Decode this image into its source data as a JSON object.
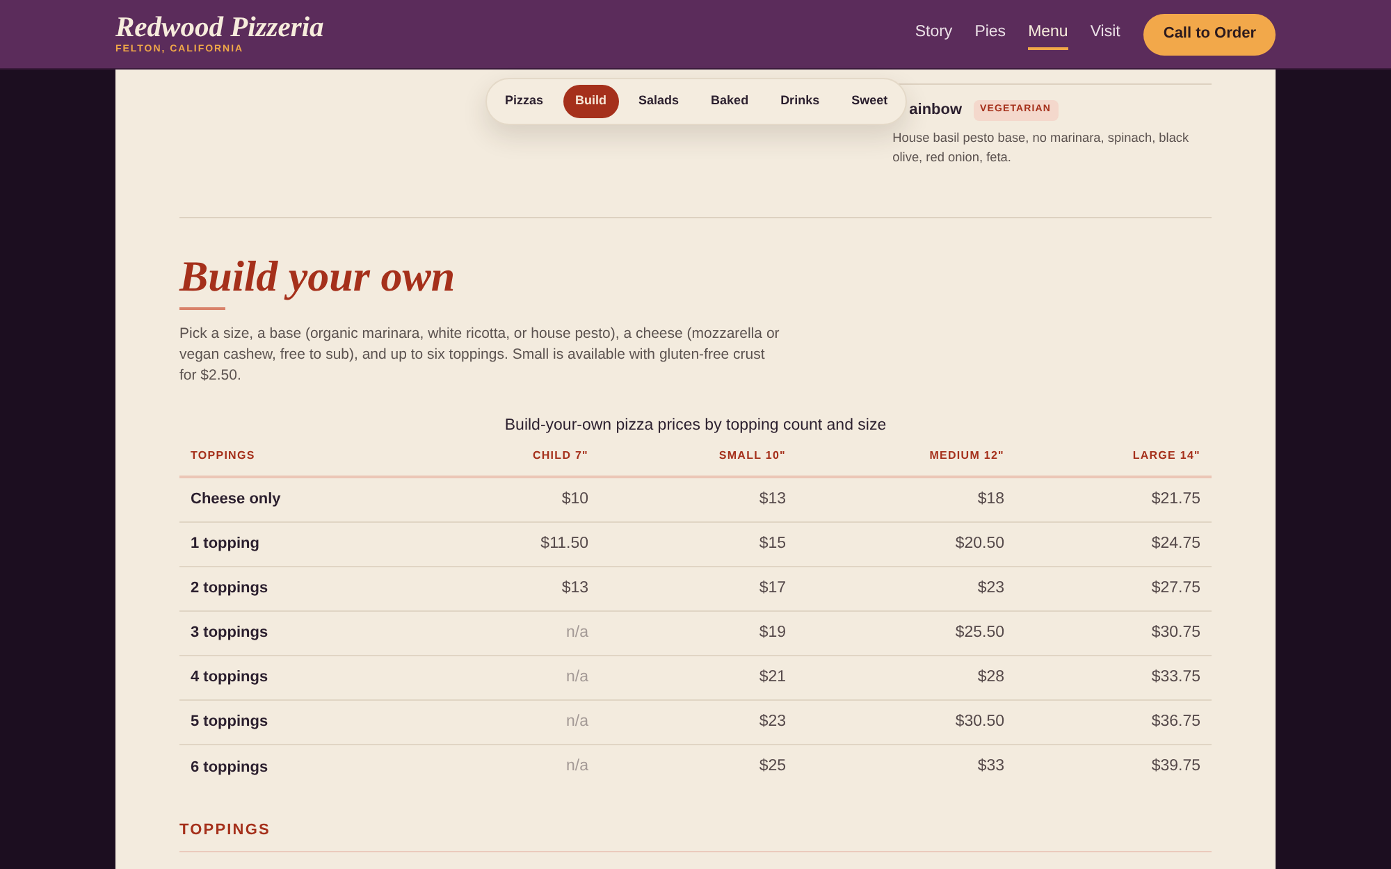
{
  "header": {
    "logo": "Redwood Pizzeria",
    "tagline": "FELTON, CALIFORNIA",
    "nav": [
      {
        "label": "Story",
        "selected": false
      },
      {
        "label": "Pies",
        "selected": false
      },
      {
        "label": "Menu",
        "selected": true
      },
      {
        "label": "Visit",
        "selected": false
      }
    ],
    "cta": "Call to Order"
  },
  "category_tabs": [
    {
      "label": "Pizzas",
      "selected": false
    },
    {
      "label": "Build",
      "selected": true
    },
    {
      "label": "Salads",
      "selected": false
    },
    {
      "label": "Baked",
      "selected": false
    },
    {
      "label": "Drinks",
      "selected": false
    },
    {
      "label": "Sweet",
      "selected": false
    }
  ],
  "previous_item": {
    "name": "ainbow",
    "badge": "VEGETARIAN",
    "description": "House basil pesto base, no marinara, spinach, black olive, red onion, feta."
  },
  "section": {
    "title": "Build your own",
    "intro": "Pick a size, a base (organic marinara, white ricotta, or house pesto), a cheese (mozzarella or vegan cashew, free to sub), and up to six toppings. Small is available with gluten-free crust for $2.50.",
    "table": {
      "caption": "Build-your-own pizza prices by topping count and size",
      "columns": [
        "TOPPINGS",
        "CHILD 7\"",
        "SMALL 10\"",
        "MEDIUM 12\"",
        "LARGE 14\""
      ],
      "rows": [
        {
          "cells": [
            {
              "kind": "label",
              "value": "Cheese only"
            },
            {
              "kind": "price",
              "value": "$10",
              "disabled": false
            },
            {
              "kind": "price",
              "value": "$13",
              "disabled": false
            },
            {
              "kind": "price",
              "value": "$18",
              "disabled": false
            },
            {
              "kind": "price",
              "value": "$21.75",
              "disabled": false
            }
          ]
        },
        {
          "cells": [
            {
              "kind": "label",
              "value": "1 topping"
            },
            {
              "kind": "price",
              "value": "$11.50",
              "disabled": false
            },
            {
              "kind": "price",
              "value": "$15",
              "disabled": false
            },
            {
              "kind": "price",
              "value": "$20.50",
              "disabled": false
            },
            {
              "kind": "price",
              "value": "$24.75",
              "disabled": false
            }
          ]
        },
        {
          "cells": [
            {
              "kind": "label",
              "value": "2 toppings"
            },
            {
              "kind": "price",
              "value": "$13",
              "disabled": false
            },
            {
              "kind": "price",
              "value": "$17",
              "disabled": false
            },
            {
              "kind": "price",
              "value": "$23",
              "disabled": false
            },
            {
              "kind": "price",
              "value": "$27.75",
              "disabled": false
            }
          ]
        },
        {
          "cells": [
            {
              "kind": "label",
              "value": "3 toppings"
            },
            {
              "kind": "price",
              "value": "n/a",
              "disabled": true
            },
            {
              "kind": "price",
              "value": "$19",
              "disabled": false
            },
            {
              "kind": "price",
              "value": "$25.50",
              "disabled": false
            },
            {
              "kind": "price",
              "value": "$30.75",
              "disabled": false
            }
          ]
        },
        {
          "cells": [
            {
              "kind": "label",
              "value": "4 toppings"
            },
            {
              "kind": "price",
              "value": "n/a",
              "disabled": true
            },
            {
              "kind": "price",
              "value": "$21",
              "disabled": false
            },
            {
              "kind": "price",
              "value": "$28",
              "disabled": false
            },
            {
              "kind": "price",
              "value": "$33.75",
              "disabled": false
            }
          ]
        },
        {
          "cells": [
            {
              "kind": "label",
              "value": "5 toppings"
            },
            {
              "kind": "price",
              "value": "n/a",
              "disabled": true
            },
            {
              "kind": "price",
              "value": "$23",
              "disabled": false
            },
            {
              "kind": "price",
              "value": "$30.50",
              "disabled": false
            },
            {
              "kind": "price",
              "value": "$36.75",
              "disabled": false
            }
          ]
        },
        {
          "cells": [
            {
              "kind": "label",
              "value": "6 toppings"
            },
            {
              "kind": "price",
              "value": "n/a",
              "disabled": true
            },
            {
              "kind": "price",
              "value": "$25",
              "disabled": false
            },
            {
              "kind": "price",
              "value": "$33",
              "disabled": false
            },
            {
              "kind": "price",
              "value": "$39.75",
              "disabled": false
            }
          ]
        }
      ]
    }
  },
  "toppings_section": {
    "title": "TOPPINGS"
  }
}
